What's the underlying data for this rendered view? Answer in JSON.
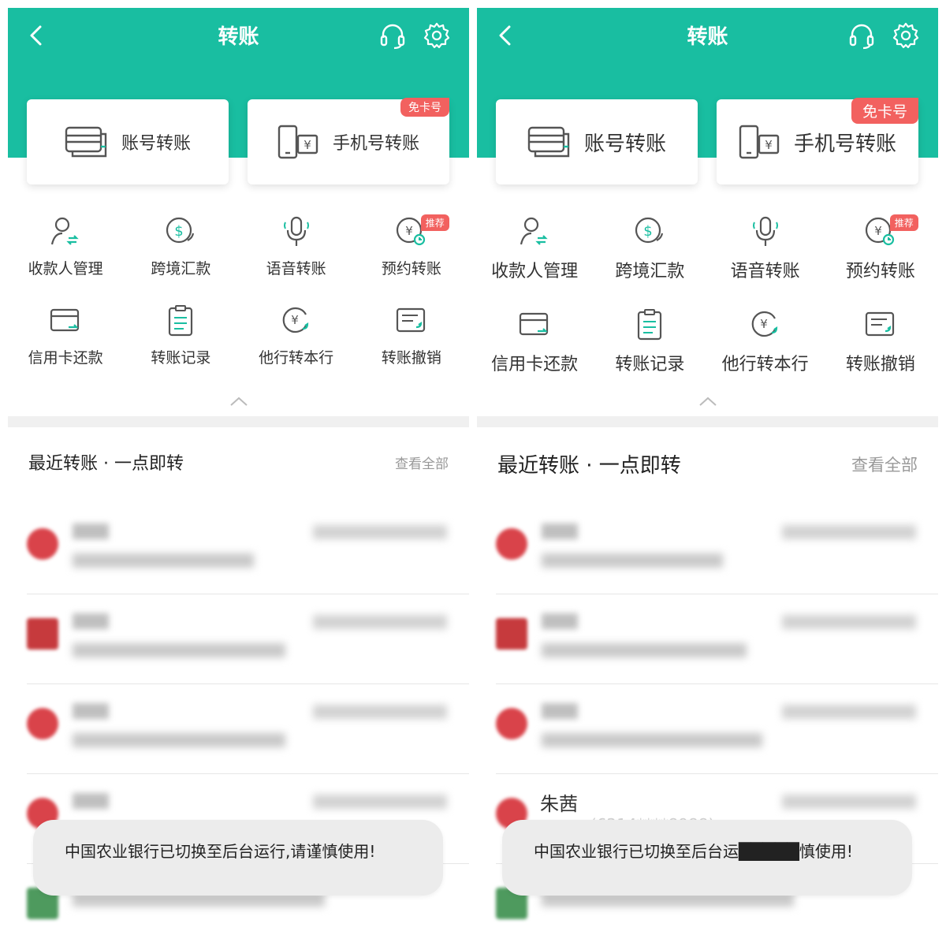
{
  "colors": {
    "accent": "#19bea1",
    "badge": "#f2615f"
  },
  "header": {
    "title": "转账",
    "icons": [
      "back-icon",
      "headset-icon",
      "gear-icon"
    ]
  },
  "cards": {
    "account_transfer": "账号转账",
    "phone_transfer": "手机号转账",
    "phone_badge": "免卡号"
  },
  "grid": {
    "items": [
      {
        "label": "收款人管理",
        "icon": "payee-icon"
      },
      {
        "label": "跨境汇款",
        "icon": "dollar-icon"
      },
      {
        "label": "语音转账",
        "icon": "microphone-icon"
      },
      {
        "label": "预约转账",
        "icon": "scheduled-transfer-icon",
        "badge": "推荐"
      },
      {
        "label": "信用卡还款",
        "icon": "credit-card-icon"
      },
      {
        "label": "转账记录",
        "icon": "clipboard-icon"
      },
      {
        "label": "他行转本行",
        "icon": "yuan-exchange-icon"
      },
      {
        "label": "转账撤销",
        "icon": "transfer-cancel-icon"
      }
    ]
  },
  "recent": {
    "title": "最近转账 · 一点即转",
    "view_all": "查看全部",
    "left_faint_bank": "招商银行(6214****8988)",
    "left_faint_name": "朱茜",
    "right_name": "朱茜",
    "right_faint_bank": "(6214****8988)"
  },
  "toast": {
    "left_text": "中国农业银行已切换至后台运行,请谨慎使用!",
    "right_text": "中国农业银行已切换至后台运█████慎使用!"
  }
}
